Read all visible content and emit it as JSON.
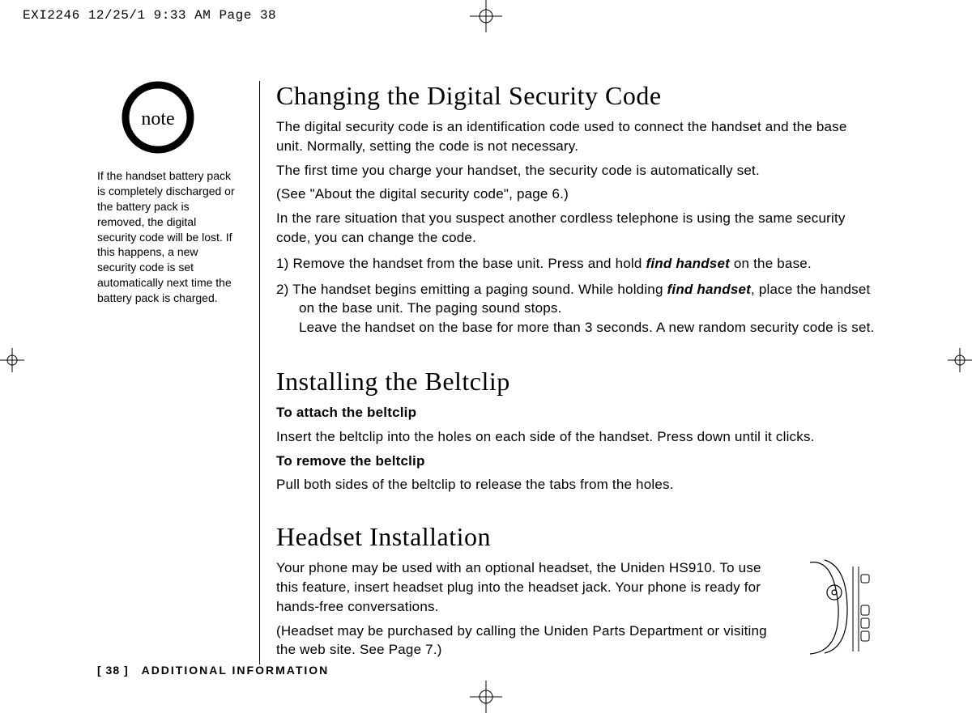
{
  "slug": "EXI2246  12/25/1 9:33 AM  Page 38",
  "sidebar": {
    "note_label": "note",
    "note_text": "If the handset battery pack is completely discharged or the battery pack is removed, the digital security code will be lost. If this happens, a new security code is set automatically next time the battery pack is charged."
  },
  "section1": {
    "title": "Changing the Digital Security Code",
    "p1": "The digital security code is an identification code used to connect the handset and the base unit. Normally, setting the code is not necessary.",
    "p2": "The first time you charge your handset, the security code is automatically set.",
    "p3": "(See \"About the digital security code\", page 6.)",
    "p4": "In the rare situation that you suspect another cordless telephone is using the same security code, you can change the code.",
    "step1_a": "1) Remove the handset from the base unit. Press and hold ",
    "step1_b": "find handset",
    "step1_c": " on the base.",
    "step2_a": "2) The handset begins emitting a paging sound. While holding ",
    "step2_b": "find handset",
    "step2_c": ", place the handset on the base unit. The paging sound stops.",
    "step2_d": "Leave the handset on the base for more than 3 seconds. A new random security code is set."
  },
  "section2": {
    "title": "Installing the Beltclip",
    "h1": "To attach the beltclip",
    "p1": "Insert the beltclip into the holes on each side of the handset. Press down until it clicks.",
    "h2": "To remove the beltclip",
    "p2": "Pull both sides of the beltclip to release the tabs from the holes."
  },
  "section3": {
    "title": "Headset Installation",
    "p1": "Your phone may be used with an optional headset, the Uniden HS910. To use this feature, insert headset plug into the headset jack. Your phone is ready for hands-free conversations.",
    "p2": "(Headset may be purchased by calling the Uniden Parts Department or visiting the web site. See Page 7.)"
  },
  "footer": {
    "page_number": "[ 38 ]",
    "section_name": "ADDITIONAL INFORMATION"
  }
}
